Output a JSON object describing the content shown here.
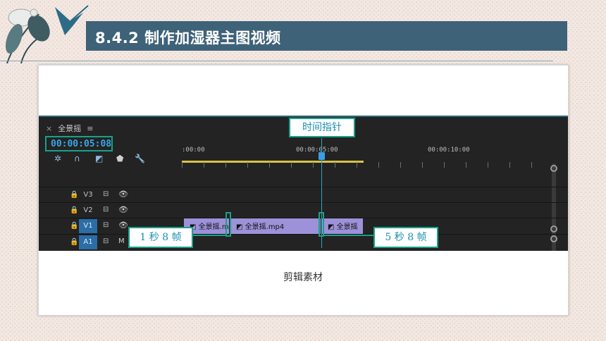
{
  "slide": {
    "title": "8.4.2    制作加湿器主图视频",
    "caption": "剪辑素材",
    "header_color": "#3e6278",
    "accent_color": "#1aa089"
  },
  "premiere": {
    "sequence_tab": "全景摇",
    "close_icon": "×",
    "menu_icon": "≡",
    "timecode": "00:00:05:08",
    "ruler_labels": [
      ":00:00",
      "00:00:05:00",
      "00:00:10:00"
    ],
    "tracks": [
      {
        "name": "V3",
        "lock": "🔒",
        "type": "video"
      },
      {
        "name": "V2",
        "lock": "🔒",
        "type": "video"
      },
      {
        "name": "V1",
        "lock": "🔒",
        "type": "video",
        "active": true
      },
      {
        "name": "A1",
        "lock": "🔒",
        "type": "audio",
        "active": true,
        "extra": "M"
      }
    ],
    "clips": [
      "全景摇.m",
      "全景摇.mp4",
      "全景摇"
    ],
    "tool_icons": [
      "snap-icon",
      "magnet-icon",
      "linked-selection-icon",
      "marker-icon",
      "wrench-icon"
    ]
  },
  "annotations": {
    "playhead_label": "时间指针",
    "left_cut_label": "1 秒 8 帧",
    "right_cut_label": "5 秒 8 帧"
  }
}
